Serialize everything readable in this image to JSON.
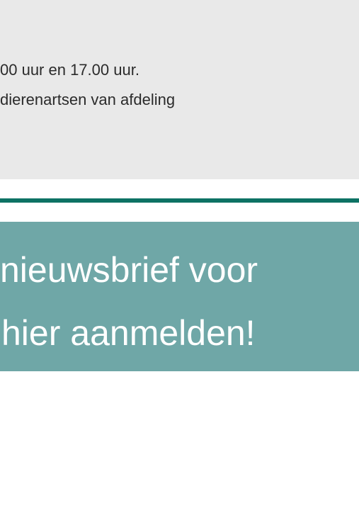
{
  "info_box": {
    "line1": "00 uur en 17.00 uur.",
    "line2": "dierenartsen van afdeling"
  },
  "newsletter": {
    "line1": "nieuwsbrief voor",
    "line2": " hier aanmelden!"
  },
  "colors": {
    "info_background": "#e9e9e9",
    "divider": "#0d7264",
    "banner_background": "#6fa7a7",
    "banner_text": "#ffffff"
  }
}
